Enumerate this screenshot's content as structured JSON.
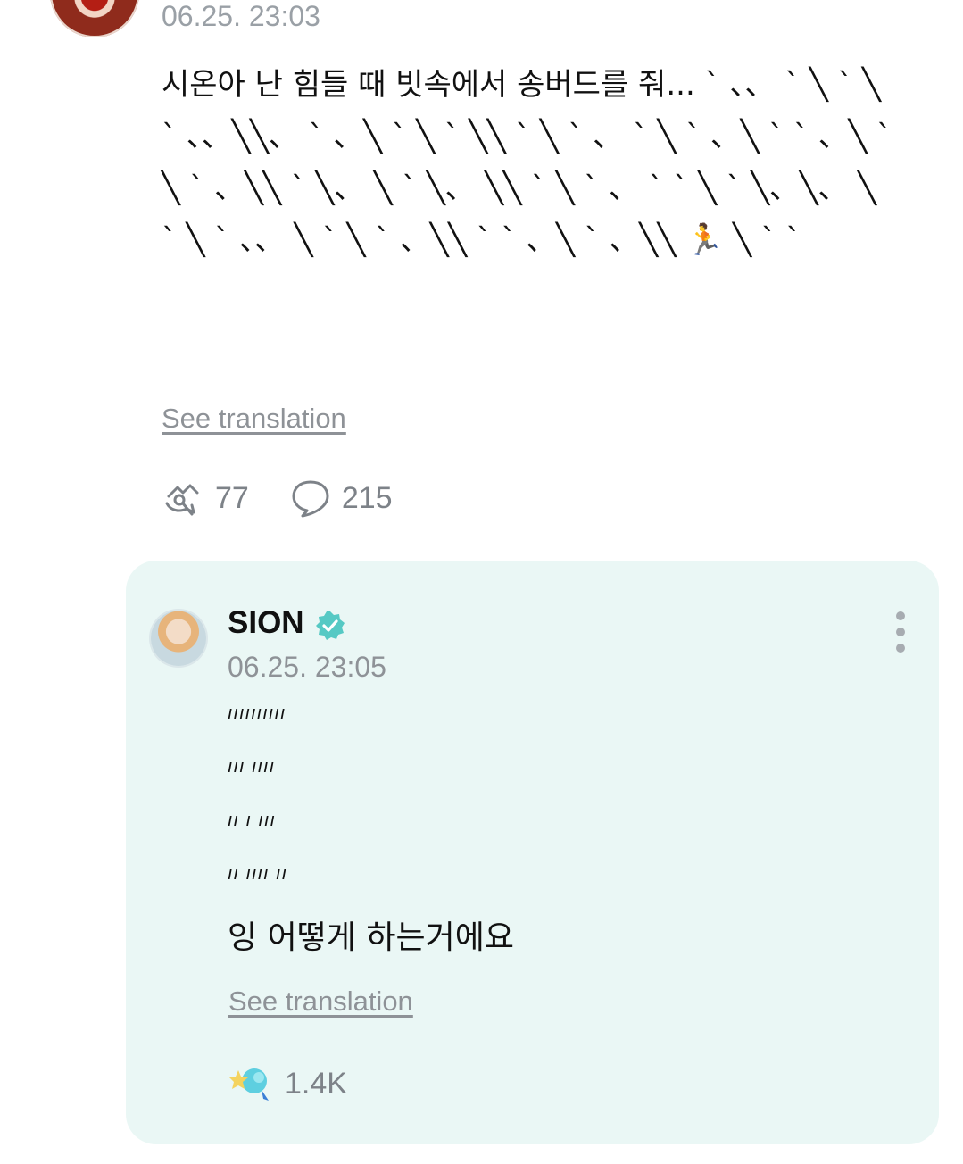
{
  "post": {
    "time": "06.25. 23:03",
    "text": "시온아 난 힘들 때 빗속에서 송버드를 줘... ` 、、 ` ╲ ` ╲ ` 、、╲╲、 ` 、╲ ` ╲ ` ╲╲ ` ╲ ` 、 ` ╲ ` 、╲ ` ` 、╲ ` ╲ ` 、╲╲ ` ╲、 ╲ ` ╲、 ╲╲ ` ╲ ` 、 ` ` ╲ ` ╲、╲、 ╲ ` ╲ ` 、、 ╲ ` ╲ ` 、╲╲ ` ` 、╲ ` 、╲╲ 🏃 ╲ ` `",
    "see_translation": "See translation",
    "repost_count": "77",
    "comment_count": "215"
  },
  "reply": {
    "name": "SION",
    "time": "06.25. 23:05",
    "lines": [
      "ıııııııııı",
      "ııı  ıııı",
      "ıı  ı  ııı",
      "ıı ıııı ıı"
    ],
    "main_text": "잉 어떻게 하는거에요",
    "see_translation": "See translation",
    "like_count": "1.4K"
  },
  "icons": {
    "repost": "repost-icon",
    "comment": "comment-bubble-icon",
    "verified": "verified-badge-icon",
    "more": "more-vertical-icon",
    "like": "artist-like-icon"
  },
  "colors": {
    "accent_teal": "#56c9c4",
    "card_bg": "#eaf7f5",
    "muted_text": "#8e9297"
  }
}
